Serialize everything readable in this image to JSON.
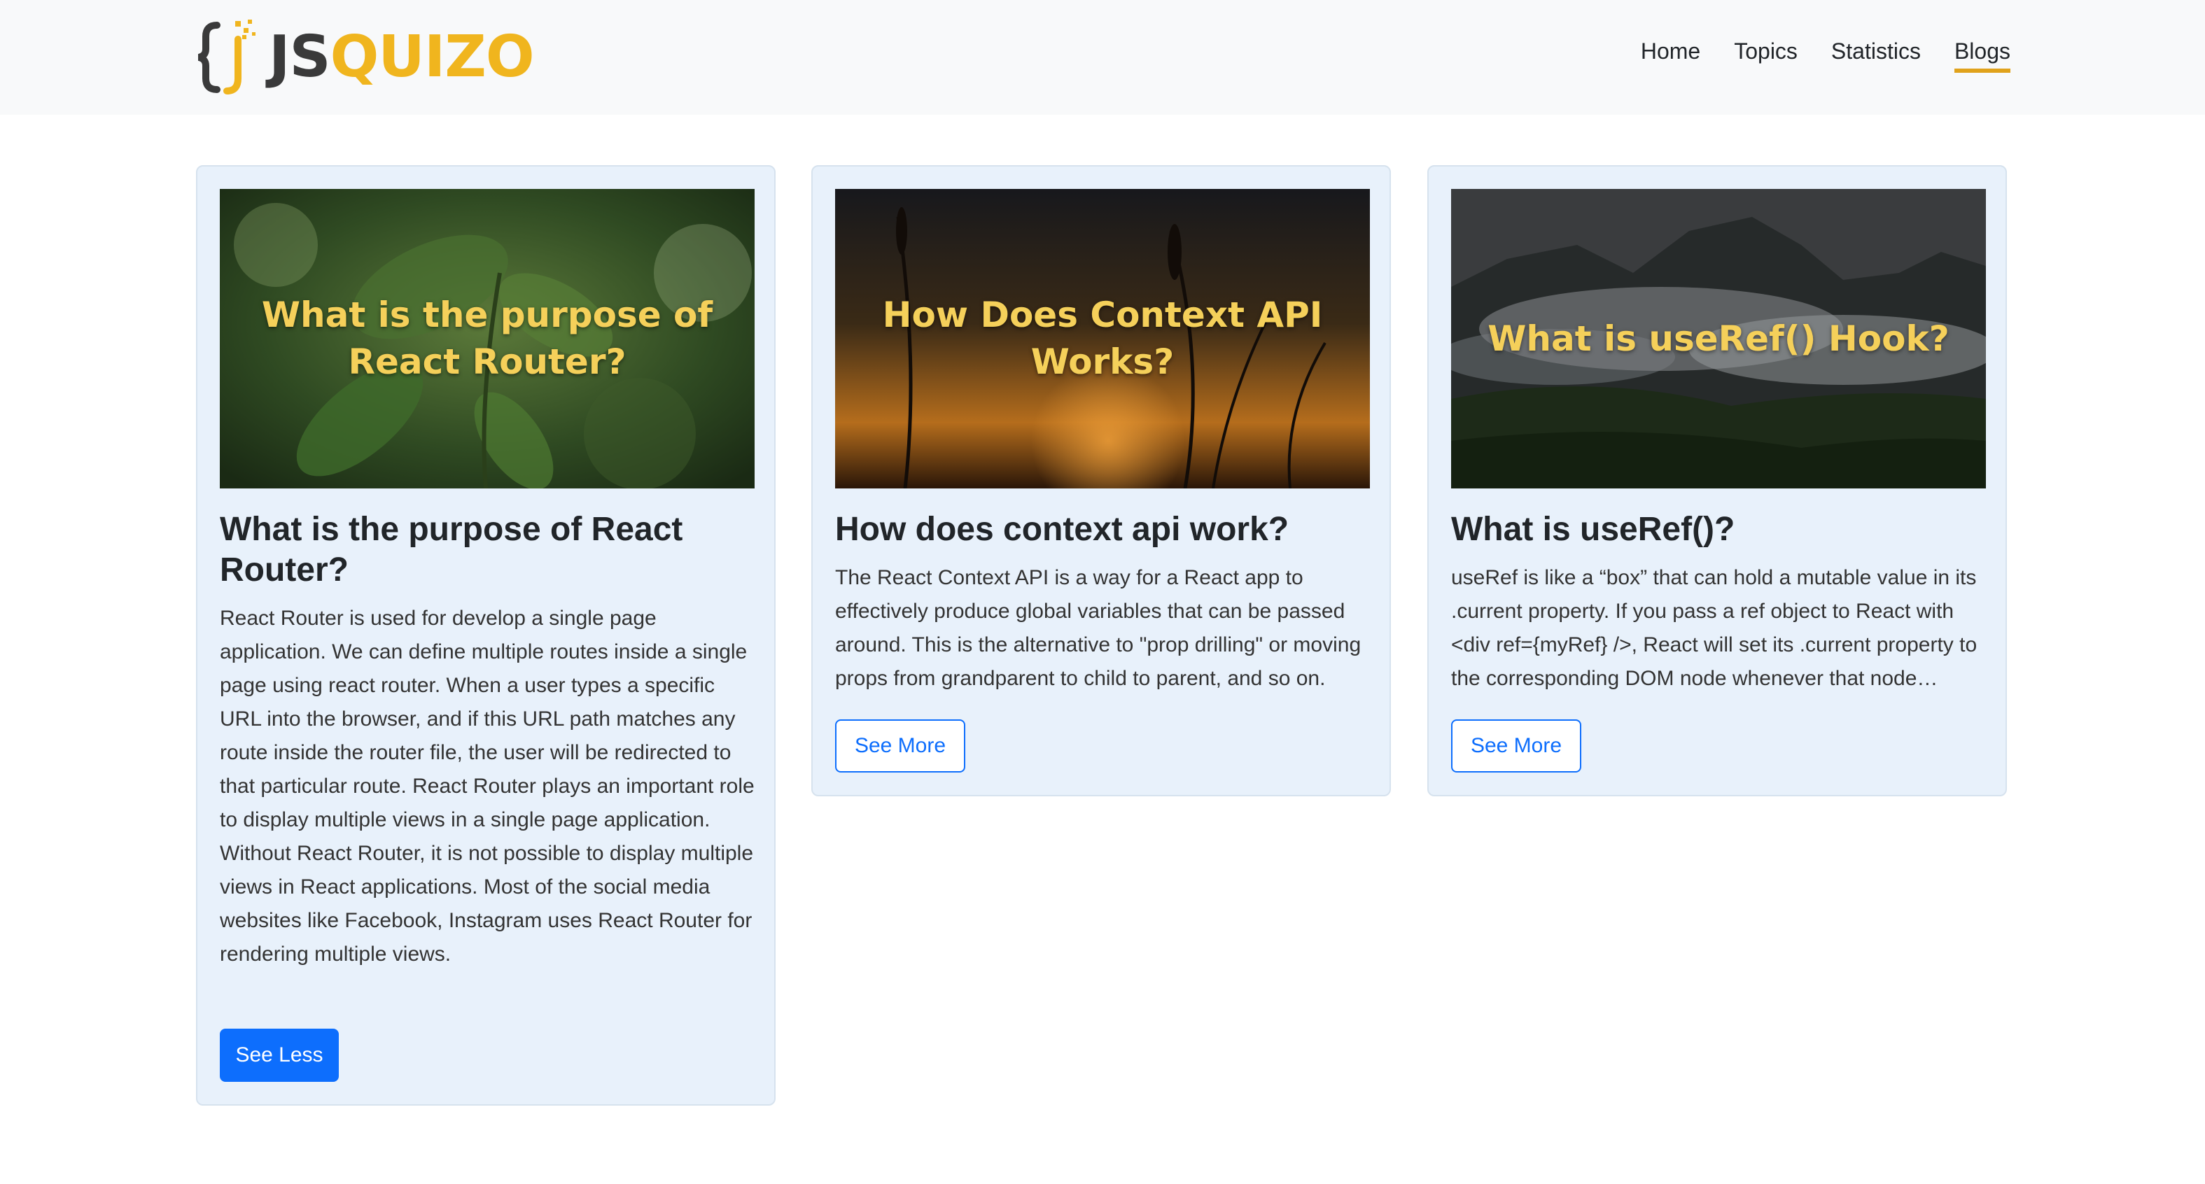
{
  "brand": {
    "js": "JS",
    "quizo": "QUIZO",
    "accent": "#f0b51e"
  },
  "nav": {
    "items": [
      {
        "label": "Home"
      },
      {
        "label": "Topics"
      },
      {
        "label": "Statistics"
      },
      {
        "label": "Blogs"
      }
    ],
    "active": "Blogs"
  },
  "cards": [
    {
      "image_caption": "What is the purpose of React Router?",
      "title": "What is the purpose of React Router?",
      "body": "React Router is used for develop a single page application. We can define multiple routes inside a single page using react router. When a user types a specific URL into the browser, and if this URL path matches any route inside the router file, the user will be redirected to that particular route. React Router plays an important role to display multiple views in a single page application. Without React Router, it is not possible to display multiple views in React applications. Most of the social media websites like Facebook, Instagram uses React Router for rendering multiple views.",
      "button": "See Less",
      "expanded": true
    },
    {
      "image_caption": "How Does Context API Works?",
      "title": "How does context api work?",
      "body": "The React Context API is a way for a React app to effectively produce global variables that can be passed around. This is the alternative to \"prop drilling\" or moving props from grandparent to child to parent, and so on.",
      "button": "See More",
      "expanded": false
    },
    {
      "image_caption": "What is useRef() Hook?",
      "title": "What is useRef()?",
      "body": "useRef is like a “box” that can hold a mutable value in its .current property. If you pass a ref object to React with <div ref={myRef} />, React will set its .current property to the corresponding DOM node whenever that node changes.",
      "button": "See More",
      "expanded": false
    }
  ],
  "colors": {
    "primary": "#0d6efd",
    "card_bg": "#e8f1fb",
    "caption": "#f5d05a"
  }
}
